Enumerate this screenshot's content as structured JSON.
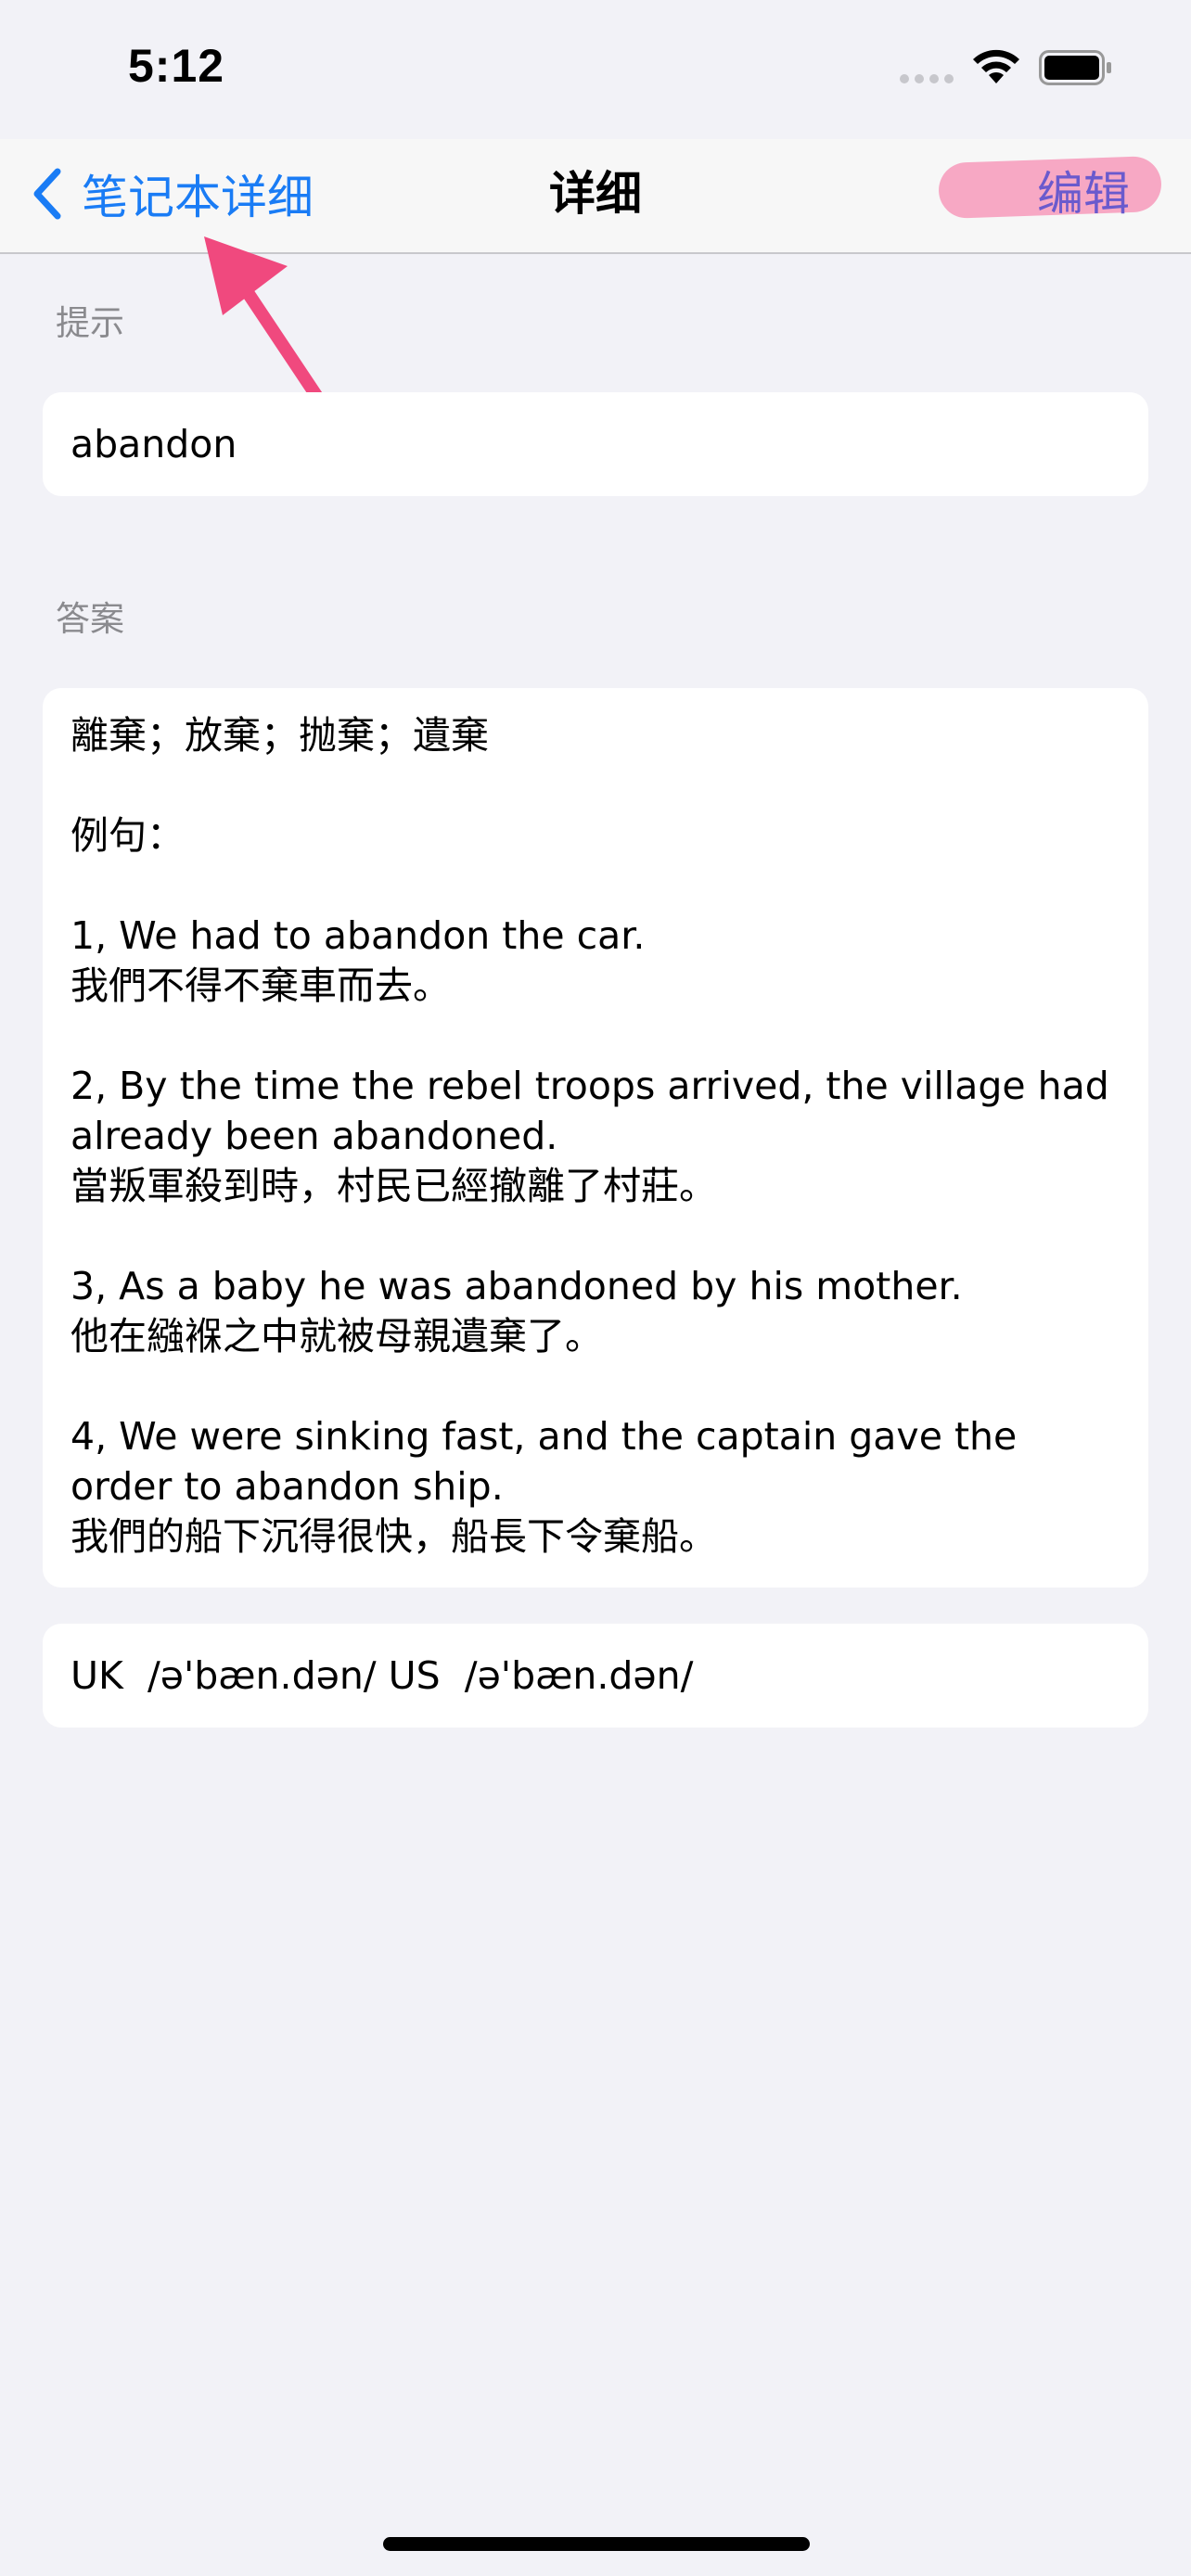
{
  "status_bar": {
    "time": "5:12"
  },
  "nav": {
    "back_label": "笔记本详细",
    "title": "详细",
    "edit_label": "编辑"
  },
  "hint_section": {
    "header": "提示",
    "value": "abandon"
  },
  "answer_section": {
    "header": "答案",
    "text": "離棄；放棄；抛棄；遺棄\n\n例句：\n\n1, We had to abandon the car.\n我們不得不棄車而去。\n\n2, By the time the rebel troops arrived, the village had already been abandoned.\n當叛軍殺到時，村民已經撤離了村莊。\n\n3, As a baby he was abandoned by his mother.\n他在繈褓之中就被母親遺棄了。\n\n4, We were sinking fast, and the captain gave the order to abandon ship.\n我們的船下沉得很快，船長下令棄船。"
  },
  "phonetic": {
    "text": "UK  /ə'bæn.dən/ US  /ə'bæn.dən/"
  },
  "colors": {
    "accent_blue": "#1a7cf5",
    "edit_purple": "#6a5acd",
    "highlight_pink": "#f7a8c4",
    "annotation_pink": "#f0497e",
    "background": "#f2f2f7"
  }
}
